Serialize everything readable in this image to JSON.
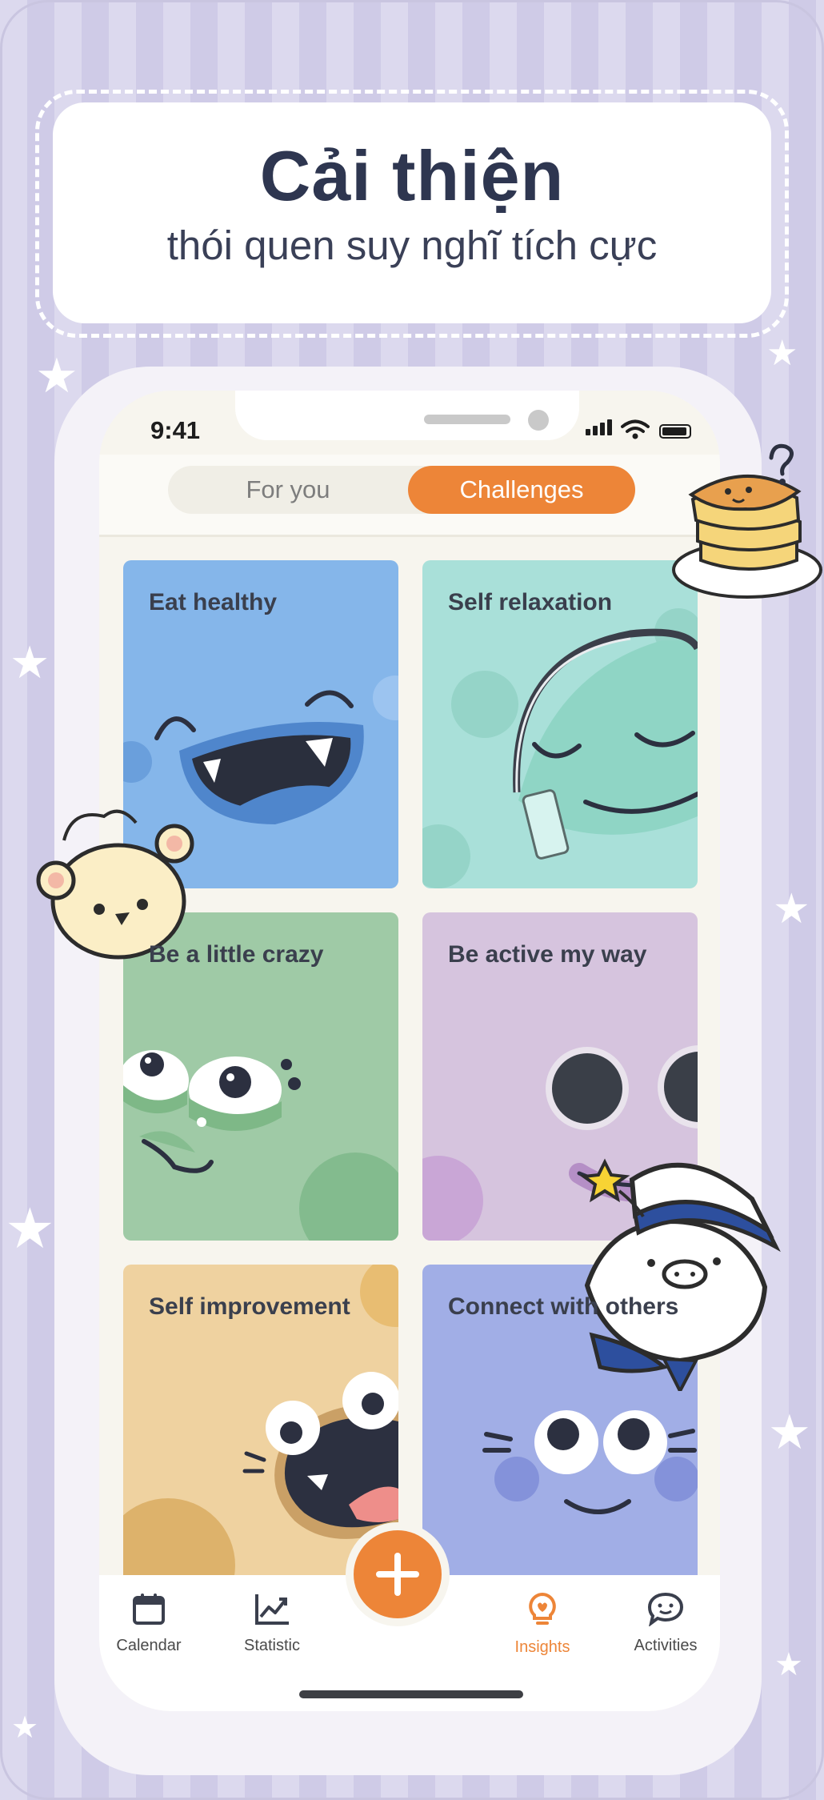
{
  "header": {
    "title": "Cải thiện",
    "subtitle": "thói quen suy nghĩ tích cực"
  },
  "status_bar": {
    "time": "9:41"
  },
  "tabs": [
    {
      "label": "For you",
      "active": false
    },
    {
      "label": "Challenges",
      "active": true
    }
  ],
  "cards": [
    {
      "label": "Eat healthy",
      "color": "#85b6ea"
    },
    {
      "label": "Self relaxation",
      "color": "#a9e0d9"
    },
    {
      "label": "Be a little crazy",
      "color": "#9fcaa6"
    },
    {
      "label": "Be active my way",
      "color": "#d6c4de"
    },
    {
      "label": "Self improvement",
      "color": "#efd2a0"
    },
    {
      "label": "Connect with others",
      "color": "#a1aee6"
    }
  ],
  "nav": [
    {
      "label": "Calendar",
      "icon": "calendar-icon",
      "active": false
    },
    {
      "label": "Statistic",
      "icon": "chart-icon",
      "active": false
    },
    {
      "label": "Insights",
      "icon": "lightbulb-icon",
      "active": true
    },
    {
      "label": "Activities",
      "icon": "chat-bubble-icon",
      "active": false
    }
  ],
  "colors": {
    "accent": "#ed8538",
    "title": "#2e3650"
  }
}
